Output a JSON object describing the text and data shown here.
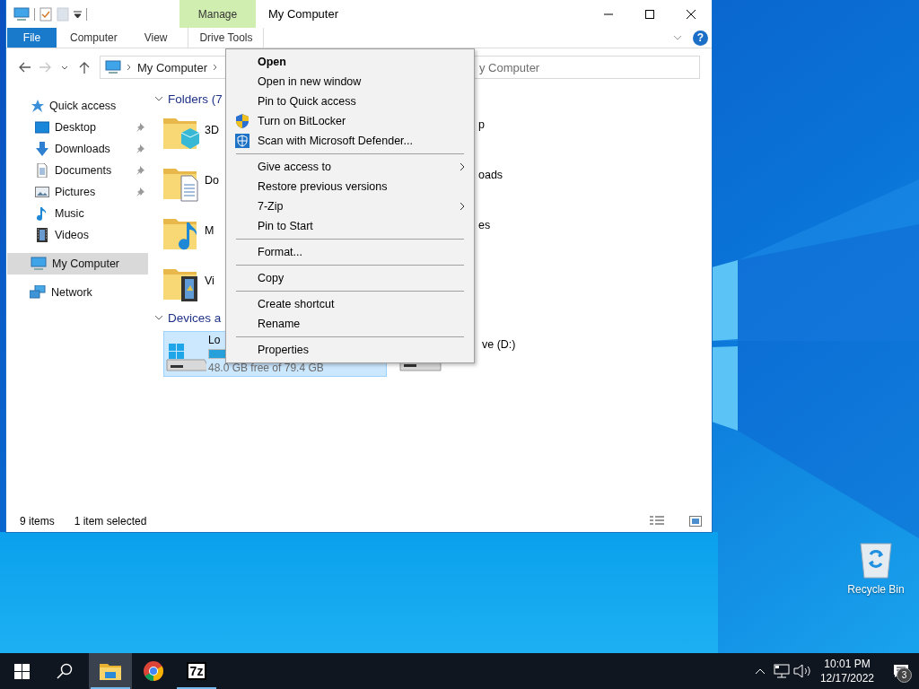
{
  "desktop": {
    "recycle_bin": {
      "label": "Recycle Bin"
    }
  },
  "explorer": {
    "title": "My Computer",
    "context_tab": "Manage",
    "ribbon_tabs": [
      {
        "label": "File",
        "kind": "file"
      },
      {
        "label": "Computer",
        "kind": "tab"
      },
      {
        "label": "View",
        "kind": "tab"
      },
      {
        "label": "Drive Tools",
        "kind": "context"
      }
    ],
    "help": "?",
    "nav_buttons": [
      {
        "kind": "back",
        "disabled": false
      },
      {
        "kind": "forward",
        "disabled": true
      },
      {
        "kind": "recent",
        "disabled": false
      },
      {
        "kind": "up",
        "disabled": false
      }
    ],
    "breadcrumb": [
      "My Computer"
    ],
    "search": {
      "placeholder": "y Computer"
    },
    "nav": [
      {
        "label": "Quick access",
        "kind": "star",
        "selected": false,
        "children": [
          {
            "label": "Desktop",
            "kind": "desktop",
            "pinned": true,
            "selected": false
          },
          {
            "label": "Downloads",
            "kind": "downloads",
            "pinned": true,
            "selected": false
          },
          {
            "label": "Documents",
            "kind": "documents",
            "pinned": true,
            "selected": false
          },
          {
            "label": "Pictures",
            "kind": "pictures",
            "pinned": true,
            "selected": false
          },
          {
            "label": "Music",
            "kind": "music",
            "pinned": false,
            "selected": false
          },
          {
            "label": "Videos",
            "kind": "videos",
            "pinned": false,
            "selected": false
          }
        ]
      },
      {
        "label": "My Computer",
        "kind": "computer",
        "selected": true
      },
      {
        "label": "Network",
        "kind": "network",
        "selected": false
      }
    ],
    "folders_header": "Folders (7",
    "folder_rows": [
      {
        "left": {
          "label": "3D",
          "kind": "cube"
        },
        "right": "p"
      },
      {
        "left": {
          "label": "Do",
          "kind": "document"
        },
        "right": "oads"
      },
      {
        "left": {
          "label": "M",
          "kind": "music"
        },
        "right": "es"
      },
      {
        "left": {
          "label": "Vi",
          "kind": "film"
        }
      }
    ],
    "devices_header": "Devices a",
    "drives": [
      {
        "label": "Lo",
        "kind": "system",
        "selected": true,
        "level": 0.38,
        "free": "48.0 GB free of 79.4 GB"
      },
      {
        "label": "ve (D:)",
        "kind": "disc",
        "selected": false
      }
    ],
    "status": {
      "count": "9 items",
      "selection": "1 item selected"
    }
  },
  "context_menu": [
    {
      "kind": "item",
      "label": "Open",
      "default": true,
      "submenu": false
    },
    {
      "kind": "item",
      "label": "Open in new window",
      "default": false,
      "submenu": false
    },
    {
      "kind": "item",
      "label": "Pin to Quick access",
      "default": false,
      "submenu": false
    },
    {
      "kind": "shield",
      "label": "Turn on BitLocker",
      "default": false,
      "submenu": false
    },
    {
      "kind": "defender",
      "label": "Scan with Microsoft Defender...",
      "default": false,
      "submenu": false
    },
    {
      "kind": "separator"
    },
    {
      "kind": "item",
      "label": "Give access to",
      "default": false,
      "submenu": true
    },
    {
      "kind": "item",
      "label": "Restore previous versions",
      "default": false,
      "submenu": false
    },
    {
      "kind": "item",
      "label": "7-Zip",
      "default": false,
      "submenu": true
    },
    {
      "kind": "item",
      "label": "Pin to Start",
      "default": false,
      "submenu": false
    },
    {
      "kind": "separator"
    },
    {
      "kind": "item",
      "label": "Format...",
      "default": false,
      "submenu": false
    },
    {
      "kind": "separator"
    },
    {
      "kind": "item",
      "label": "Copy",
      "default": false,
      "submenu": false
    },
    {
      "kind": "separator"
    },
    {
      "kind": "item",
      "label": "Create shortcut",
      "default": false,
      "submenu": false
    },
    {
      "kind": "item",
      "label": "Rename",
      "default": false,
      "submenu": false
    },
    {
      "kind": "separator"
    },
    {
      "kind": "item",
      "label": "Properties",
      "default": false,
      "submenu": false
    }
  ],
  "taskbar": {
    "apps": [
      {
        "kind": "explorer",
        "selected": true,
        "running": true
      },
      {
        "kind": "chrome",
        "selected": false,
        "running": false
      },
      {
        "kind": "sevenzip",
        "label": "7z",
        "selected": false,
        "running": true
      }
    ],
    "time": "10:01 PM",
    "date": "12/17/2022",
    "notifications": "3"
  }
}
